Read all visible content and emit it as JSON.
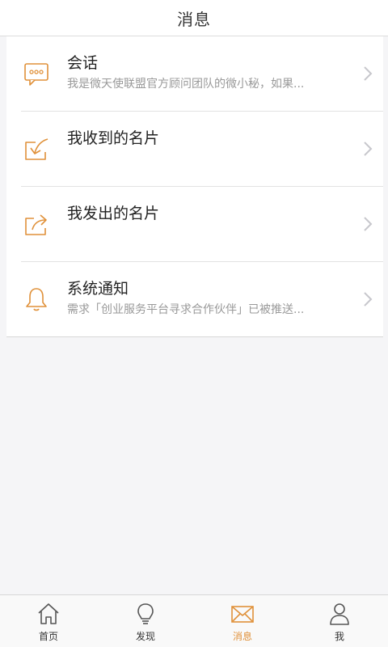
{
  "header": {
    "title": "消息"
  },
  "colors": {
    "accent": "#e0913a",
    "text_primary": "#222222",
    "text_secondary": "#999999",
    "background": "#f5f5f7"
  },
  "messages": [
    {
      "icon": "chat-bubble-icon",
      "title": "会话",
      "subtitle": "我是微天使联盟官方顾问团队的微小秘，如果..."
    },
    {
      "icon": "card-received-icon",
      "title": "我收到的名片",
      "subtitle": ""
    },
    {
      "icon": "card-sent-icon",
      "title": "我发出的名片",
      "subtitle": ""
    },
    {
      "icon": "bell-icon",
      "title": "系统通知",
      "subtitle": "需求「创业服务平台寻求合作伙伴」已被推送..."
    }
  ],
  "tabbar": {
    "tabs": [
      {
        "icon": "home-icon",
        "label": "首页",
        "active": false
      },
      {
        "icon": "lightbulb-icon",
        "label": "发现",
        "active": false
      },
      {
        "icon": "envelope-icon",
        "label": "消息",
        "active": true
      },
      {
        "icon": "user-icon",
        "label": "我",
        "active": false
      }
    ]
  }
}
